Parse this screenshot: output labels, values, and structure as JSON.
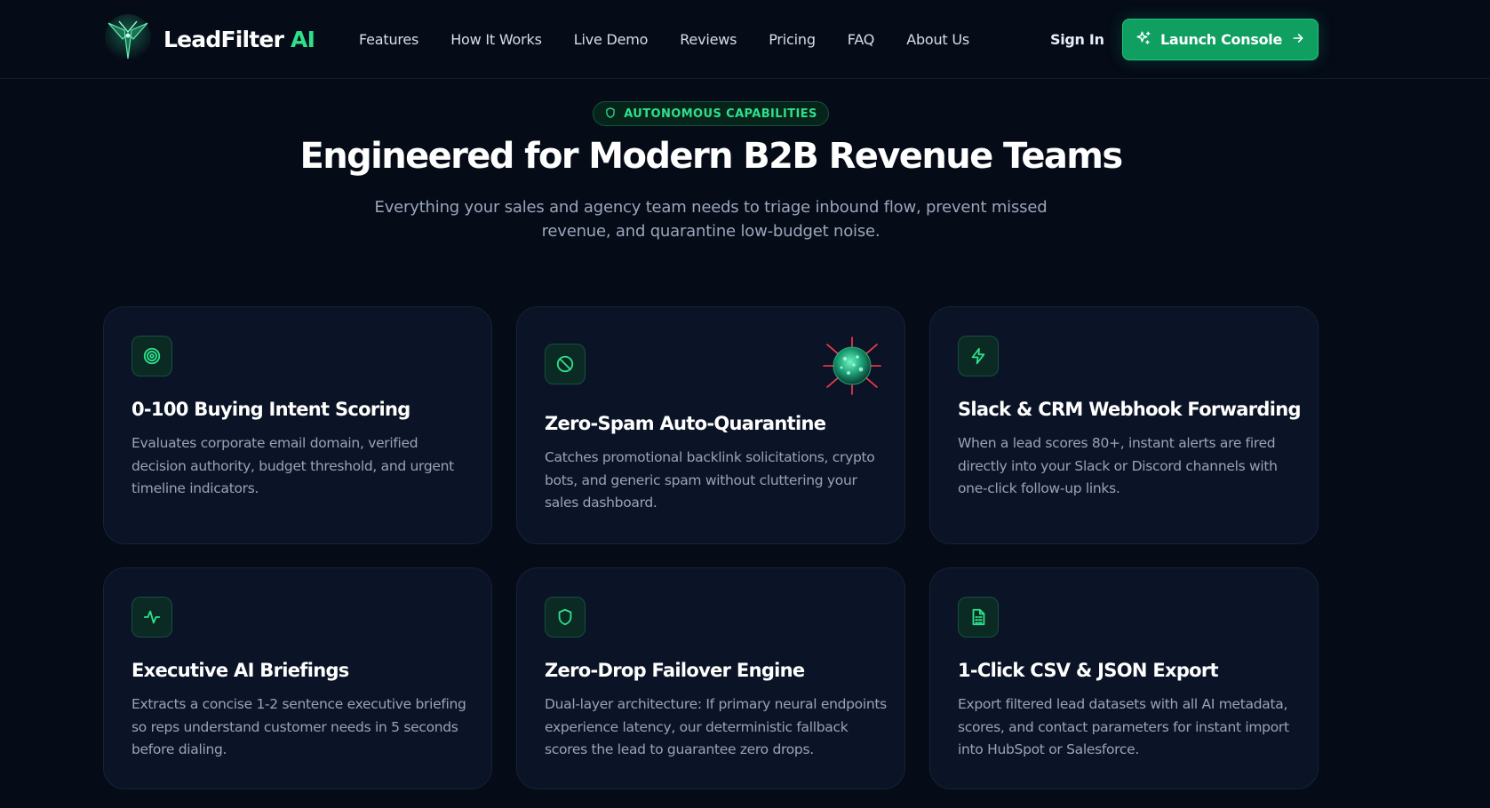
{
  "brand": {
    "name": "LeadFilter",
    "accent": "AI"
  },
  "nav": {
    "links": [
      "Features",
      "How It Works",
      "Live Demo",
      "Reviews",
      "Pricing",
      "FAQ",
      "About Us"
    ],
    "sign_in": "Sign In",
    "cta": {
      "label": "Launch Console",
      "icon": "sparkles-icon",
      "trailing_icon": "arrow-right-icon"
    }
  },
  "hero": {
    "badge": {
      "label": "AUTONOMOUS CAPABILITIES",
      "icon": "shield-icon"
    },
    "title": "Engineered for Modern B2B Revenue Teams",
    "subtitle": "Everything your sales and agency team needs to triage inbound flow, prevent missed revenue, and quarantine low-budget noise."
  },
  "features": [
    {
      "icon": "target-icon",
      "title": "0-100 Buying Intent Scoring",
      "desc": "Evaluates corporate email domain, verified decision authority, budget threshold, and urgent timeline indicators."
    },
    {
      "icon": "ban-icon",
      "title": "Zero-Spam Auto-Quarantine",
      "desc": "Catches promotional backlink solicitations, crypto bots, and generic spam without cluttering your sales dashboard.",
      "illustration": "virus-icon"
    },
    {
      "icon": "zap-icon",
      "title": "Slack & CRM Webhook Forwarding",
      "desc": "When a lead scores 80+, instant alerts are fired directly into your Slack or Discord channels with one-click follow-up links."
    },
    {
      "icon": "activity-icon",
      "title": "Executive AI Briefings",
      "desc": "Extracts a concise 1-2 sentence executive briefing so reps understand customer needs in 5 seconds before dialing."
    },
    {
      "icon": "shield-icon",
      "title": "Zero-Drop Failover Engine",
      "desc": "Dual-layer architecture: If primary neural endpoints experience latency, our deterministic fallback scores the lead to guarantee zero drops."
    },
    {
      "icon": "file-spreadsheet-icon",
      "title": "1-Click CSV & JSON Export",
      "desc": "Export filtered lead datasets with all AI metadata, scores, and contact parameters for instant import into HubSpot or Salesforce."
    }
  ],
  "colors": {
    "background": "#050b17",
    "card": "#0b1426",
    "accent": "#2ee08c",
    "button": "#0e9f61",
    "muted_text": "#98a3b6"
  }
}
